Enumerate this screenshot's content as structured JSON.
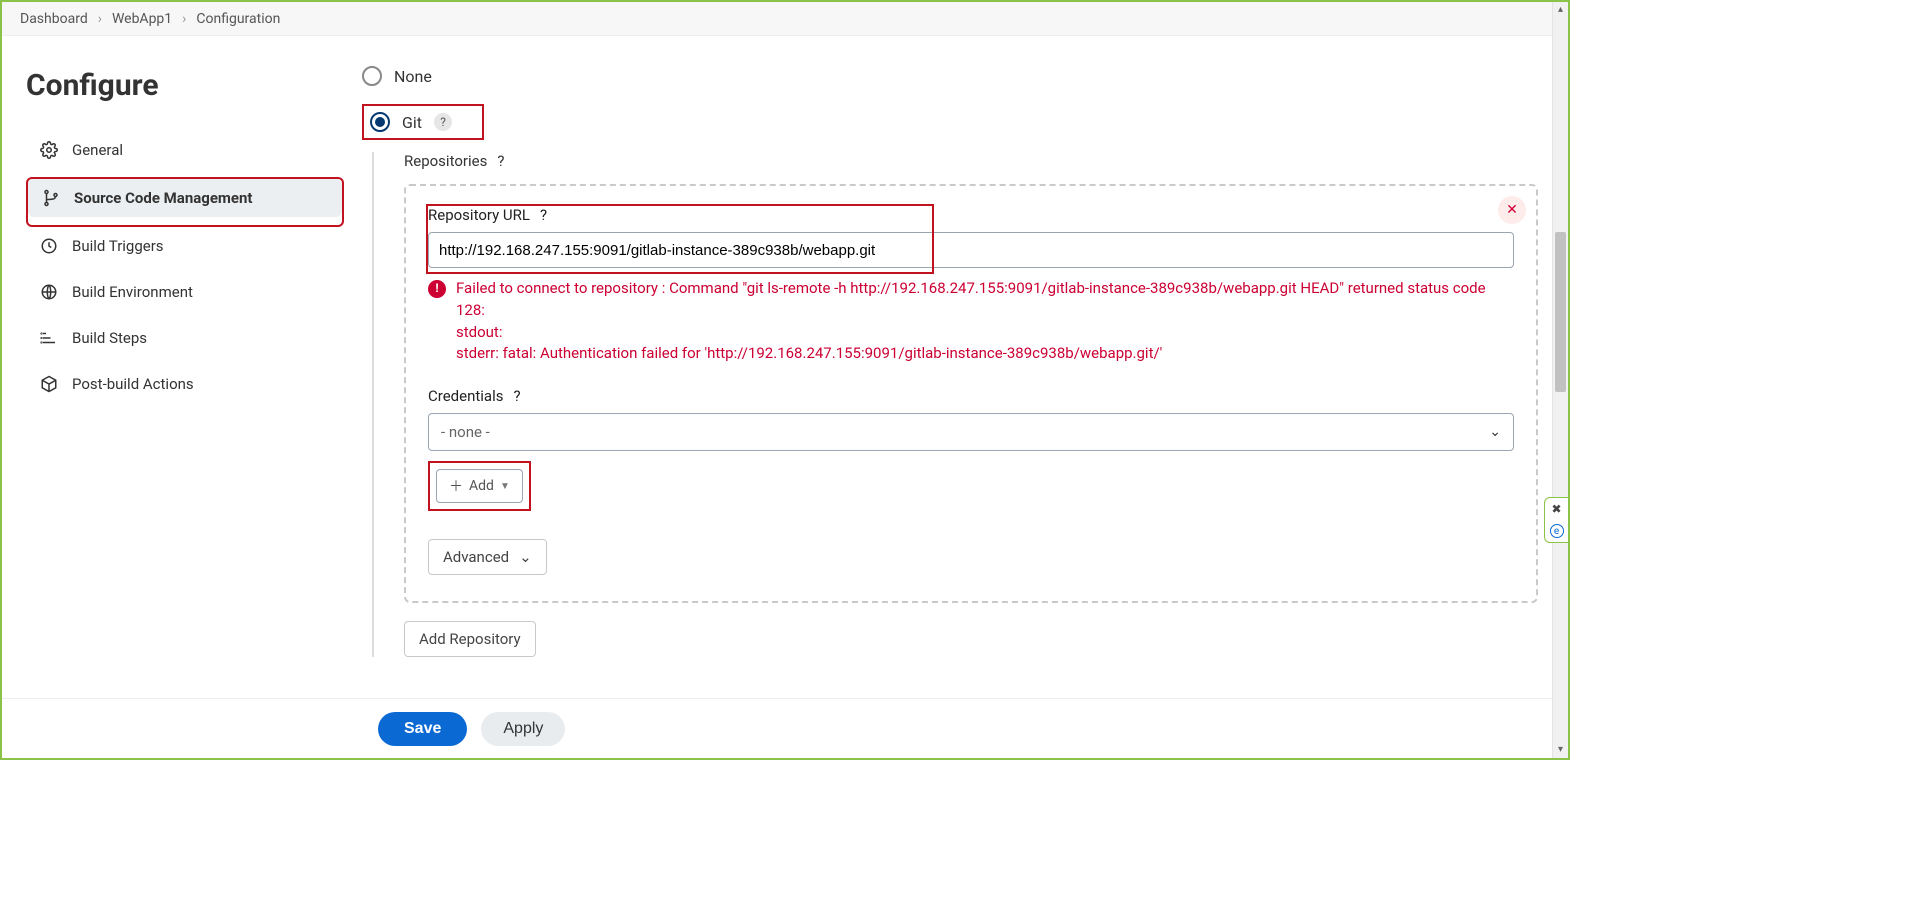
{
  "breadcrumb": {
    "items": [
      "Dashboard",
      "WebApp1",
      "Configuration"
    ]
  },
  "page_title": "Configure",
  "sidebar": {
    "items": [
      {
        "label": "General"
      },
      {
        "label": "Source Code Management"
      },
      {
        "label": "Build Triggers"
      },
      {
        "label": "Build Environment"
      },
      {
        "label": "Build Steps"
      },
      {
        "label": "Post-build Actions"
      }
    ],
    "active_index": 1
  },
  "scm": {
    "options": [
      {
        "label": "None",
        "selected": false
      },
      {
        "label": "Git",
        "selected": true
      }
    ],
    "repositories_label": "Repositories",
    "repo_url_label": "Repository URL",
    "repo_url_value": "http://192.168.247.155:9091/gitlab-instance-389c938b/webapp.git",
    "error_lines": [
      "Failed to connect to repository : Command \"git ls-remote -h http://192.168.247.155:9091/gitlab-instance-389c938b/webapp.git HEAD\" returned status code 128:",
      "stdout:",
      "stderr: fatal: Authentication failed for 'http://192.168.247.155:9091/gitlab-instance-389c938b/webapp.git/'"
    ],
    "credentials_label": "Credentials",
    "credentials_value": "- none -",
    "add_label": "Add",
    "advanced_label": "Advanced",
    "add_repository_label": "Add Repository"
  },
  "footer": {
    "save": "Save",
    "apply": "Apply"
  }
}
